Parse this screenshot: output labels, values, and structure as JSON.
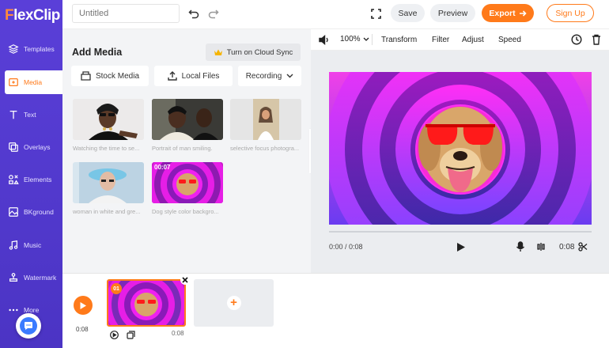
{
  "app": {
    "logo_f": "F",
    "logo_rest": "lexClip"
  },
  "sidebar": {
    "items": [
      {
        "label": "Templates",
        "icon": "layers-icon"
      },
      {
        "label": "Media",
        "icon": "media-icon",
        "active": true
      },
      {
        "label": "Text",
        "icon": "text-icon"
      },
      {
        "label": "Overlays",
        "icon": "overlays-icon"
      },
      {
        "label": "Elements",
        "icon": "elements-icon"
      },
      {
        "label": "BKground",
        "icon": "background-icon"
      },
      {
        "label": "Music",
        "icon": "music-icon"
      },
      {
        "label": "Watermark",
        "icon": "watermark-icon"
      },
      {
        "label": "More",
        "icon": "more-icon"
      }
    ]
  },
  "topbar": {
    "title_placeholder": "Untitled",
    "save_label": "Save",
    "preview_label": "Preview",
    "export_label": "Export",
    "signup_label": "Sign Up"
  },
  "media_panel": {
    "title": "Add Media",
    "cloud_sync_label": "Turn on Cloud Sync",
    "stock_media_label": "Stock Media",
    "local_files_label": "Local Files",
    "recording_label": "Recording",
    "thumbnails": [
      {
        "caption": "Watching the time to se..."
      },
      {
        "caption": "Portrait of man smiling."
      },
      {
        "caption": "selective focus photogra..."
      },
      {
        "caption": "woman in white and gre..."
      },
      {
        "caption": "Dog style color backgro...",
        "duration": "00:07"
      }
    ]
  },
  "preview_toolbar": {
    "zoom": "100%",
    "transform_label": "Transform",
    "filter_label": "Filter",
    "adjust_label": "Adjust",
    "speed_label": "Speed"
  },
  "player": {
    "time_position": "0:00 / 0:08",
    "duration": "0:08"
  },
  "timeline": {
    "current_time": "0:08",
    "clip_number": "01",
    "clip_duration": "0:08"
  },
  "colors": {
    "accent": "#ff7a1a",
    "sidebar": "#4b34c4"
  }
}
